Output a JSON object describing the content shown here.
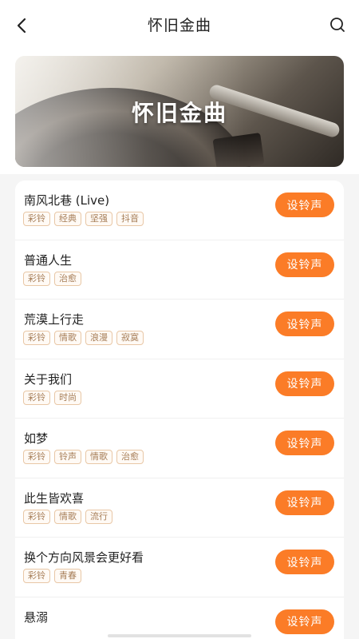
{
  "header": {
    "title": "怀旧金曲",
    "back_icon": "chevron-left-icon",
    "search_icon": "search-icon"
  },
  "banner": {
    "title": "怀旧金曲"
  },
  "button_label": "设铃声",
  "accent_color": "#fb7c27",
  "songs": [
    {
      "name": "南风北巷 (Live)",
      "tags": [
        "彩铃",
        "经典",
        "坚强",
        "抖音"
      ]
    },
    {
      "name": "普通人生",
      "tags": [
        "彩铃",
        "治愈"
      ]
    },
    {
      "name": "荒漠上行走",
      "tags": [
        "彩铃",
        "情歌",
        "浪漫",
        "寂寞"
      ]
    },
    {
      "name": "关于我们",
      "tags": [
        "彩铃",
        "时尚"
      ]
    },
    {
      "name": "如梦",
      "tags": [
        "彩铃",
        "铃声",
        "情歌",
        "治愈"
      ]
    },
    {
      "name": "此生皆欢喜",
      "tags": [
        "彩铃",
        "情歌",
        "流行"
      ]
    },
    {
      "name": "换个方向风景会更好看",
      "tags": [
        "彩铃",
        "青春"
      ]
    },
    {
      "name": "悬溺",
      "tags": []
    }
  ]
}
